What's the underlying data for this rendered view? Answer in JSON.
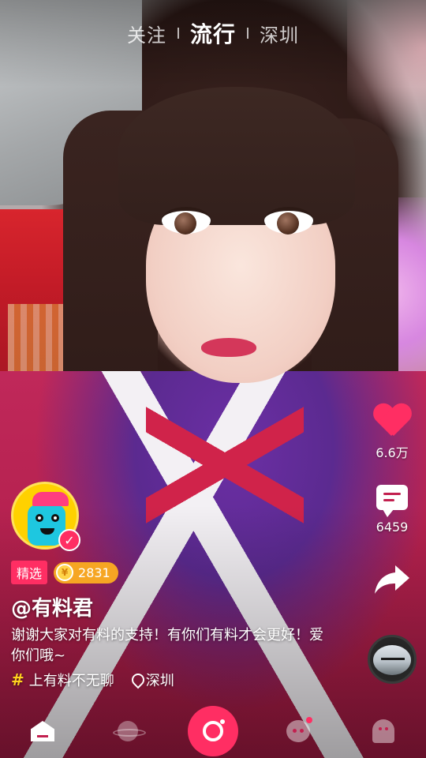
{
  "header": {
    "tabs": [
      {
        "label": "关注"
      },
      {
        "label": "流行"
      },
      {
        "label": "深圳"
      }
    ],
    "active_tab": "流行"
  },
  "actions": {
    "like": {
      "icon": "heart-icon",
      "count": "6.6万",
      "color": "#ff2e63"
    },
    "comment": {
      "icon": "comment-icon",
      "count": "6459"
    },
    "share": {
      "icon": "share-arrow-icon"
    },
    "music": {
      "icon": "music-disc-icon"
    }
  },
  "creator": {
    "handle": "@有料君",
    "verified": "✓",
    "badge_label": "精选",
    "coin_symbol": "¥",
    "coins": "2831"
  },
  "post": {
    "caption": "谢谢大家对有料的支持！有你们有料才会更好！爱你们哦~",
    "topic_symbol": "#",
    "topic": "上有料不无聊",
    "location": "深圳"
  },
  "bottom_nav": [
    {
      "name": "home",
      "icon": "home-icon"
    },
    {
      "name": "discover",
      "icon": "planet-icon"
    },
    {
      "name": "record",
      "icon": "camera-record-icon"
    },
    {
      "name": "messages",
      "icon": "chat-face-icon",
      "has_dot": true
    },
    {
      "name": "me",
      "icon": "profile-ghost-icon"
    }
  ],
  "colors": {
    "accent": "#ff2e63",
    "coin": "#f6a623",
    "topic": "#ffd21e"
  }
}
